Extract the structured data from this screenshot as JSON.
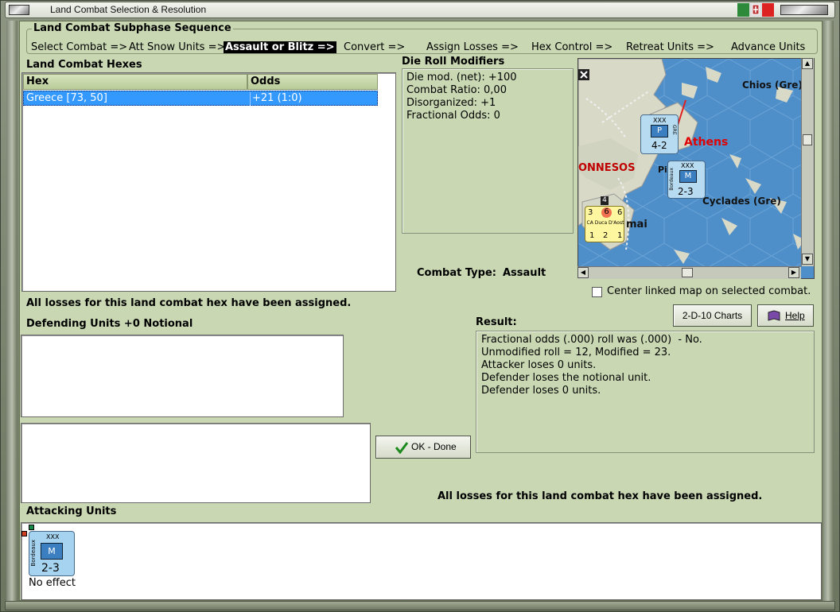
{
  "window": {
    "title": "Land Combat Selection & Resolution"
  },
  "sequence": {
    "heading": "Land Combat Subphase Sequence",
    "steps": [
      "Select Combat =>",
      "Att Snow Units =>",
      "Assault or Blitz =>",
      "Convert =>",
      "Assign Losses =>",
      "Hex Control =>",
      "Retreat Units =>",
      "Advance Units"
    ],
    "active_index": 2
  },
  "hexes": {
    "heading": "Land Combat Hexes",
    "columns": [
      "Hex",
      "Odds"
    ],
    "rows": [
      {
        "hex": "Greece [73, 50]",
        "odds": "+21 (1:0)"
      }
    ]
  },
  "modifiers": {
    "heading": "Die Roll Modifiers",
    "lines": [
      "Die mod. (net): +100",
      "",
      "Combat Ratio: 0,00",
      "Disorganized: +1",
      "Fractional Odds: 0"
    ]
  },
  "combat_type": {
    "label": "Combat Type:",
    "value": "Assault"
  },
  "map": {
    "labels": {
      "chios": "Chios (Gre)",
      "athens": "Athens",
      "peloponnesos": "ONNESOS",
      "cyclades": "Cyclades (Gre)",
      "kalamai": "mai",
      "piraeus": "Pi"
    },
    "units": [
      {
        "corps": "XXX",
        "type": "P",
        "strength": "4-2",
        "side": "GRE"
      },
      {
        "corps": "XXX",
        "type": "M",
        "strength": "2-3",
        "side": "Bordeaux"
      }
    ],
    "ship": {
      "top_left": "3",
      "top_mid": "6",
      "top_right": "6",
      "name": "CA Duca D'Aost",
      "bottom": [
        "1",
        "2",
        "1"
      ],
      "badge": "4"
    }
  },
  "center_map": {
    "label": "Center linked map on selected combat.",
    "checked": false
  },
  "buttons": {
    "charts": "2-D-10 Charts",
    "help": "Help",
    "ok": "OK - Done"
  },
  "status_top": "All losses for this land combat hex have been assigned.",
  "status_bottom": "All losses for this land combat hex have been assigned.",
  "defending": {
    "heading": "Defending Units +0 Notional"
  },
  "result": {
    "heading": "Result:",
    "lines": [
      "Fractional odds (.000) roll was (.000)  - No.",
      "Unmodified roll = 12, Modified = 23.",
      "Attacker loses 0 units.",
      "Defender loses the notional unit.",
      "Defender loses 0 units."
    ]
  },
  "attacking": {
    "heading": "Attacking Units",
    "units": [
      {
        "corps": "XXX",
        "type": "M",
        "strength": "2-3",
        "side": "Bordeaux",
        "status": "No effect"
      }
    ]
  },
  "colors": {
    "panel_bg": "#c9d8b3",
    "selection": "#3399ff",
    "sea": "#4f8fc9",
    "athens_label": "#e00000"
  }
}
